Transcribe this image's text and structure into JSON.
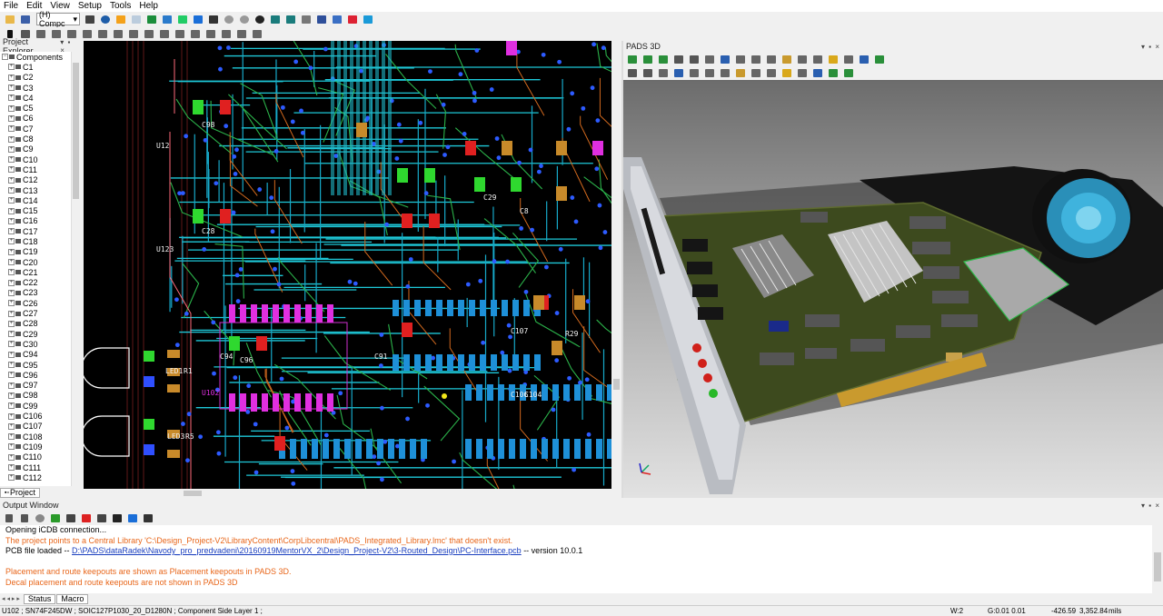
{
  "menu": [
    "File",
    "Edit",
    "View",
    "Setup",
    "Tools",
    "Help"
  ],
  "toolbar": {
    "mode_select": "(H) Compc"
  },
  "project_explorer": {
    "title": "Project Explorer",
    "root": "Components",
    "items": [
      "C1",
      "C2",
      "C3",
      "C4",
      "C5",
      "C6",
      "C7",
      "C8",
      "C9",
      "C10",
      "C11",
      "C12",
      "C13",
      "C14",
      "C15",
      "C16",
      "C17",
      "C18",
      "C19",
      "C20",
      "C21",
      "C22",
      "C23",
      "C26",
      "C27",
      "C28",
      "C29",
      "C30",
      "C94",
      "C95",
      "C96",
      "C97",
      "C98",
      "C99",
      "C106",
      "C107",
      "C108",
      "C109",
      "C110",
      "C111",
      "C112"
    ],
    "tab": "Project"
  },
  "pcb": {
    "labels": [
      "U12",
      "U123",
      "LED1",
      "R1",
      "LED3",
      "R5",
      "U102",
      "C96",
      "C98",
      "C28",
      "C91",
      "C8",
      "C29",
      "C106",
      "C104",
      "C107",
      "C94",
      "R29"
    ]
  },
  "pads3d": {
    "title": "PADS 3D"
  },
  "output": {
    "title": "Output Window",
    "lines": [
      {
        "text": "Opening iCDB connection...",
        "type": "normal"
      },
      {
        "text": "The project points to a Central Library 'C:\\Design_Project-V2\\LibraryContent\\CorpLibcentral\\PADS_Integrated_Library.lmc' that doesn't exist.",
        "type": "orange"
      },
      {
        "prefix": "PCB file loaded -- ",
        "link": "D:\\PADS\\dataRadek\\Navody_pro_predvadeni\\20160919MentorVX_2\\Design_Project-V2\\3-Routed_Design\\PC-Interface.pcb",
        "suffix": " -- version 10.0.1",
        "type": "link"
      },
      {
        "text": "",
        "type": "normal"
      },
      {
        "text": "Placement and route keepouts are shown as Placement keepouts in PADS 3D.",
        "type": "orange"
      },
      {
        "text": "Decal placement and route keepouts are not shown in PADS 3D",
        "type": "orange"
      }
    ],
    "tabs": [
      "Status",
      "Macro"
    ]
  },
  "status": {
    "part": "U102 ; SN74F245DW ; SOIC127P1030_20_D1280N ; Component Side Layer 1 ;",
    "width": "W:2",
    "grid": "G:0.01 0.01",
    "x": "-426.59",
    "y": "3,352.84",
    "units": "mils"
  },
  "colors": {
    "orange": "#e8661a",
    "link": "#1a3fbf",
    "pcb_bg": "#000000"
  }
}
